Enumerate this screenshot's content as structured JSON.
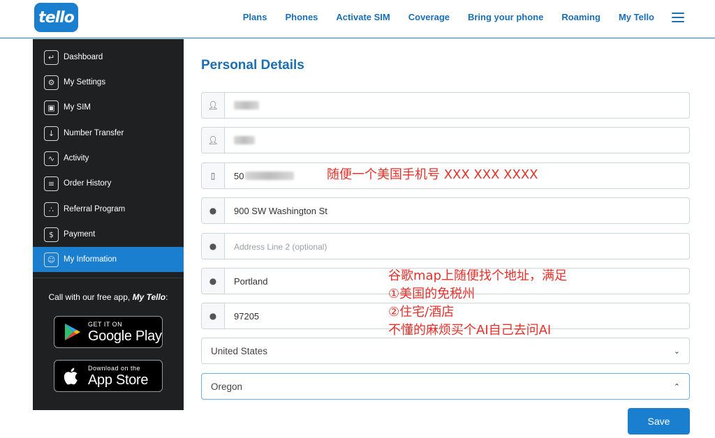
{
  "header": {
    "logo_text": "tello",
    "nav": [
      "Plans",
      "Phones",
      "Activate SIM",
      "Coverage",
      "Bring your phone",
      "Roaming",
      "My Tello"
    ]
  },
  "sidebar": {
    "items": [
      {
        "label": "Dashboard",
        "icon": "dashboard-icon",
        "glyph": "↵"
      },
      {
        "label": "My Settings",
        "icon": "settings-icon",
        "glyph": "⚙"
      },
      {
        "label": "My SIM",
        "icon": "sim-icon",
        "glyph": "▣"
      },
      {
        "label": "Number Transfer",
        "icon": "number-transfer-icon",
        "glyph": "↓"
      },
      {
        "label": "Activity",
        "icon": "activity-icon",
        "glyph": "∿"
      },
      {
        "label": "Order History",
        "icon": "order-history-icon",
        "glyph": "≡"
      },
      {
        "label": "Referral Program",
        "icon": "referral-icon",
        "glyph": "∴"
      },
      {
        "label": "Payment",
        "icon": "payment-icon",
        "glyph": "$"
      },
      {
        "label": "My Information",
        "icon": "user-icon",
        "glyph": "☺"
      }
    ],
    "active_index": 8,
    "app_caption_prefix": "Call with our free app, ",
    "app_caption_brand": "My Tello",
    "app_caption_suffix": ":",
    "google_play": {
      "small": "GET IT ON",
      "big": "Google Play"
    },
    "app_store": {
      "small": "Download on the",
      "big": "App Store"
    }
  },
  "main": {
    "title": "Personal Details",
    "fields": {
      "phone_prefix": "50",
      "address1": "900 SW Washington St",
      "address2_placeholder": "Address Line 2 (optional)",
      "city": "Portland",
      "zip": "97205",
      "country": "United States",
      "state": "Oregon"
    },
    "save_label": "Save"
  },
  "annotations": {
    "phone_note": "随便一个美国手机号 XXX XXX XXXX",
    "address_note": [
      "谷歌map上随便找个地址，满足",
      "①美国的免税州",
      "②住宅/酒店",
      "不懂的麻烦买个AI自己去问AI"
    ]
  },
  "colors": {
    "brand_blue": "#1a7fcf",
    "nav_blue": "#1a6fb5",
    "sidebar_bg": "#1f2021",
    "annotation_red": "#e8302a"
  }
}
